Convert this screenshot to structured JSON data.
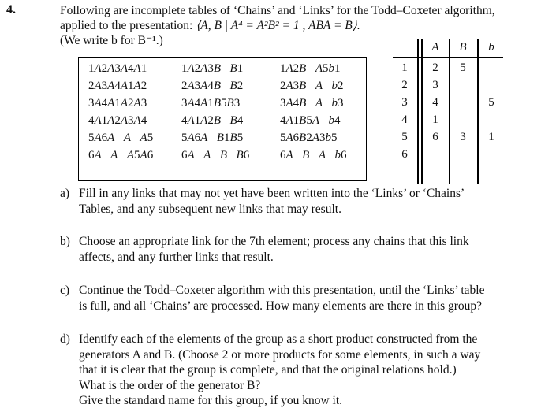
{
  "question": {
    "number": "4.",
    "intro_line1": "Following are incomplete tables of ‘Chains’ and ‘Links’ for the Todd–Coxeter algorithm,",
    "intro_line2_prefix": "applied to the presentation: ",
    "presentation": "⟨A, B | A⁴ = A²B² = 1 , ABA = B⟩.",
    "intro_line3": "(We write b for B⁻¹.)"
  },
  "chains": {
    "rows": [
      [
        "1A2A3A4A1",
        "1A2A3B B1",
        "1A2B A5b1"
      ],
      [
        "2A3A4A1A2",
        "2A3A4B B2",
        "2A3B A b2"
      ],
      [
        "3A4A1A2A3",
        "3A4A1B5B3",
        "3A4B A b3"
      ],
      [
        "4A1A2A3A4",
        "4A1A2B B4",
        "4A1B5A b4"
      ],
      [
        "5A6A A A5",
        "5A6A B1B5",
        "5A6B2A3b5"
      ],
      [
        "6A A A5A6",
        "6A A B B6",
        "6A B A b6"
      ]
    ]
  },
  "links": {
    "headers": [
      "A",
      "B",
      "b"
    ],
    "rows": [
      {
        "el": "1",
        "A": "2",
        "B": "5",
        "b": ""
      },
      {
        "el": "2",
        "A": "3",
        "B": "",
        "b": ""
      },
      {
        "el": "3",
        "A": "4",
        "B": "",
        "b": "5"
      },
      {
        "el": "4",
        "A": "1",
        "B": "",
        "b": ""
      },
      {
        "el": "5",
        "A": "6",
        "B": "3",
        "b": "1"
      },
      {
        "el": "6",
        "A": "",
        "B": "",
        "b": ""
      }
    ]
  },
  "parts": [
    {
      "label": "a)",
      "lines": [
        "Fill in any links that may not yet have been written into the ‘Links’ or ‘Chains’",
        "Tables, and any subsequent new links that may result."
      ]
    },
    {
      "label": "b)",
      "lines": [
        "Choose an appropriate link for the 7th element; process any chains that this link",
        "affects, and any further links that result."
      ]
    },
    {
      "label": "c)",
      "lines": [
        "Continue the Todd–Coxeter algorithm with this presentation, until the ‘Links’ table",
        "is full, and all ‘Chains’ are processed. How many elements are there in this group?"
      ]
    },
    {
      "label": "d)",
      "lines": [
        "Identify each of the elements of the group as a short product constructed from the",
        "generators A and B. (Choose 2 or more products for some elements, in such a way",
        "that it is clear that the group is complete, and that the original relations hold.)",
        "What is the order of the generator B?",
        "Give the standard name for this group, if you know it."
      ]
    }
  ]
}
